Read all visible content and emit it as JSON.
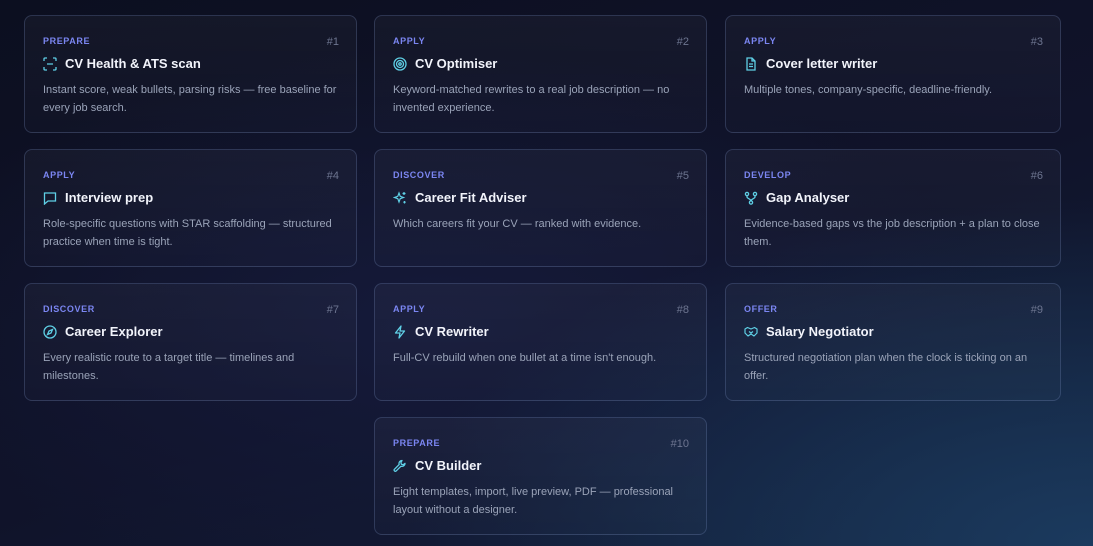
{
  "cards": [
    {
      "tag": "PREPARE",
      "num": "#1",
      "title": "CV Health & ATS scan",
      "desc": "Instant score, weak bullets, parsing risks — free baseline for every job search.",
      "icon": "scan-icon"
    },
    {
      "tag": "APPLY",
      "num": "#2",
      "title": "CV Optimiser",
      "desc": "Keyword-matched rewrites to a real job description — no invented experience.",
      "icon": "target-icon"
    },
    {
      "tag": "APPLY",
      "num": "#3",
      "title": "Cover letter writer",
      "desc": "Multiple tones, company-specific, deadline-friendly.",
      "icon": "document-icon"
    },
    {
      "tag": "APPLY",
      "num": "#4",
      "title": "Interview prep",
      "desc": "Role-specific questions with STAR scaffolding — structured practice when time is tight.",
      "icon": "chat-icon"
    },
    {
      "tag": "DISCOVER",
      "num": "#5",
      "title": "Career Fit Adviser",
      "desc": "Which careers fit your CV — ranked with evidence.",
      "icon": "sparkles-icon"
    },
    {
      "tag": "DEVELOP",
      "num": "#6",
      "title": "Gap Analyser",
      "desc": "Evidence-based gaps vs the job description + a plan to close them.",
      "icon": "branch-icon"
    },
    {
      "tag": "DISCOVER",
      "num": "#7",
      "title": "Career Explorer",
      "desc": "Every realistic route to a target title — timelines and milestones.",
      "icon": "compass-icon"
    },
    {
      "tag": "APPLY",
      "num": "#8",
      "title": "CV Rewriter",
      "desc": "Full-CV rebuild when one bullet at a time isn't enough.",
      "icon": "lightning-icon"
    },
    {
      "tag": "OFFER",
      "num": "#9",
      "title": "Salary Negotiator",
      "desc": "Structured negotiation plan when the clock is ticking on an offer.",
      "icon": "handshake-icon"
    },
    {
      "tag": "PREPARE",
      "num": "#10",
      "title": "CV Builder",
      "desc": "Eight templates, import, live preview, PDF — professional layout without a designer.",
      "icon": "wrench-icon"
    }
  ],
  "colors": {
    "accent": "#7b86f2",
    "icon": "#5fd0e6",
    "title": "#f2f4fb",
    "desc": "#9aa3b8"
  }
}
